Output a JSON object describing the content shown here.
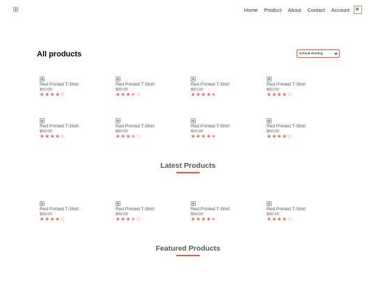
{
  "nav": {
    "links": [
      "Home",
      "Product",
      "About",
      "Contact",
      "Account"
    ]
  },
  "page": {
    "title": "All products",
    "sort_selected": "Default shorting"
  },
  "colors": {
    "accent": "#ff523b",
    "text": "#555555"
  },
  "products": {
    "all_row1": [
      {
        "name": "Red Printed T-Shirt",
        "price": "$50.00",
        "rating": 4
      },
      {
        "name": "Red Printed T-Shirt",
        "price": "$50.00",
        "rating": 3.5
      },
      {
        "name": "Red Printed T-Shirt",
        "price": "$50.00",
        "rating": 4.5
      },
      {
        "name": "Red Printed T-Shirt",
        "price": "$50.00",
        "rating": 4
      }
    ],
    "all_row2": [
      {
        "name": "Red Printed T-Shirt",
        "price": "$50.00",
        "rating": 4
      },
      {
        "name": "Red Printed T-Shirt",
        "price": "$50.00",
        "rating": 3.5
      },
      {
        "name": "Red Printed T-Shirt",
        "price": "$50.00",
        "rating": 4.5
      },
      {
        "name": "Red Printed T-Shirt",
        "price": "$50.00",
        "rating": 4
      }
    ],
    "latest": [
      {
        "name": "Red Printed T-Shirt",
        "price": "$50.00",
        "rating": 4
      },
      {
        "name": "Red Printed T-Shirt",
        "price": "$50.00",
        "rating": 3.5
      },
      {
        "name": "Red Printed T-Shirt",
        "price": "$50.00",
        "rating": 4.5
      },
      {
        "name": "Red Printed T-Shirt",
        "price": "$50.00",
        "rating": 4
      }
    ]
  },
  "sections": {
    "latest_title": "Latest Products",
    "featured_title": "Featured Products"
  }
}
